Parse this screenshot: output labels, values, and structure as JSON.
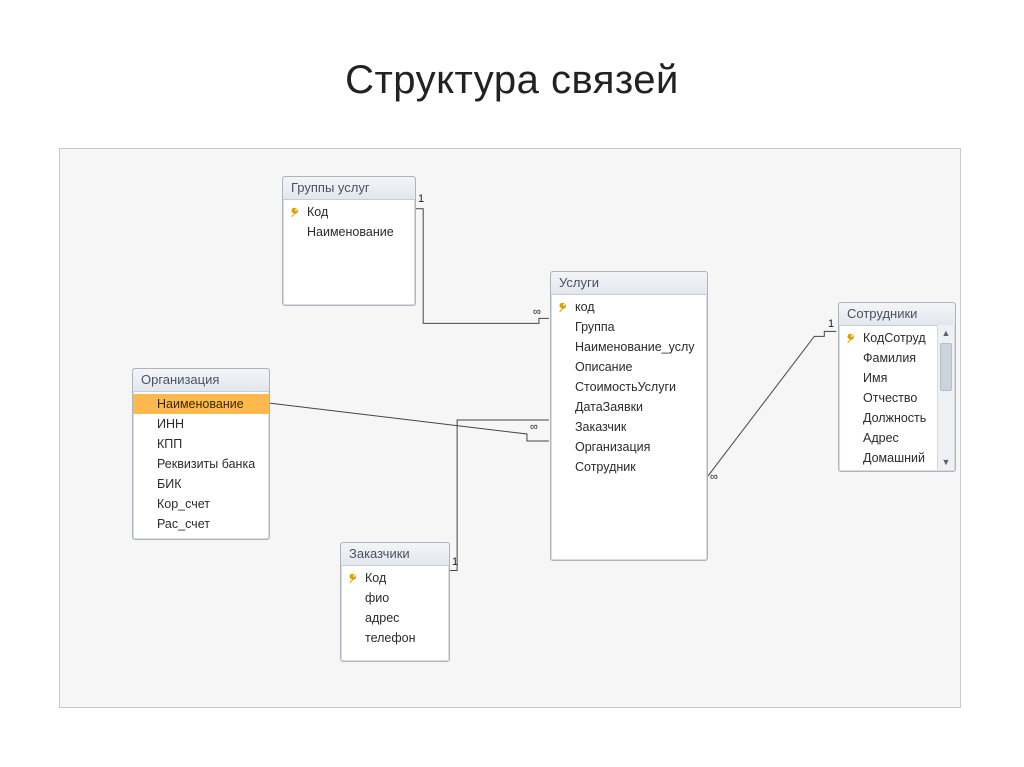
{
  "title": "Структура связей",
  "tables": {
    "groups": {
      "header": "Группы услуг",
      "fields": [
        {
          "name": "Код",
          "pk": true
        },
        {
          "name": "Наименование",
          "pk": false
        }
      ]
    },
    "services": {
      "header": "Услуги",
      "fields": [
        {
          "name": "код",
          "pk": true
        },
        {
          "name": "Группа",
          "pk": false
        },
        {
          "name": "Наименование_услу",
          "pk": false
        },
        {
          "name": "Описание",
          "pk": false
        },
        {
          "name": "СтоимостьУслуги",
          "pk": false
        },
        {
          "name": "ДатаЗаявки",
          "pk": false
        },
        {
          "name": "Заказчик",
          "pk": false
        },
        {
          "name": "Организация",
          "pk": false
        },
        {
          "name": "Сотрудник",
          "pk": false
        }
      ]
    },
    "org": {
      "header": "Организация",
      "fields": [
        {
          "name": "Наименование",
          "pk": false,
          "selected": true
        },
        {
          "name": "ИНН",
          "pk": false
        },
        {
          "name": "КПП",
          "pk": false
        },
        {
          "name": "Реквизиты банка",
          "pk": false
        },
        {
          "name": "БИК",
          "pk": false
        },
        {
          "name": "Кор_счет",
          "pk": false
        },
        {
          "name": "Рас_счет",
          "pk": false
        }
      ]
    },
    "customers": {
      "header": "Заказчики",
      "fields": [
        {
          "name": "Код",
          "pk": true
        },
        {
          "name": "фио",
          "pk": false
        },
        {
          "name": "адрес",
          "pk": false
        },
        {
          "name": "телефон",
          "pk": false
        }
      ]
    },
    "employees": {
      "header": "Сотрудники",
      "fields": [
        {
          "name": "КодСотруд",
          "pk": true
        },
        {
          "name": "Фамилия",
          "pk": false
        },
        {
          "name": "Имя",
          "pk": false
        },
        {
          "name": "Отчество",
          "pk": false
        },
        {
          "name": "Должность",
          "pk": false
        },
        {
          "name": "Адрес",
          "pk": false
        },
        {
          "name": "Домашний",
          "pk": false
        }
      ]
    }
  },
  "cardinality": {
    "one": "1",
    "many": "∞"
  },
  "relationships": [
    {
      "from": "groups.Код",
      "to": "services.Группа",
      "type": "1-to-many"
    },
    {
      "from": "org.Наименование",
      "to": "services.Организация",
      "type": "1-to-many"
    },
    {
      "from": "customers.Код",
      "to": "services.Заказчик",
      "type": "1-to-many"
    },
    {
      "from": "employees.КодСотруд",
      "to": "services.Сотрудник",
      "type": "1-to-many"
    }
  ]
}
